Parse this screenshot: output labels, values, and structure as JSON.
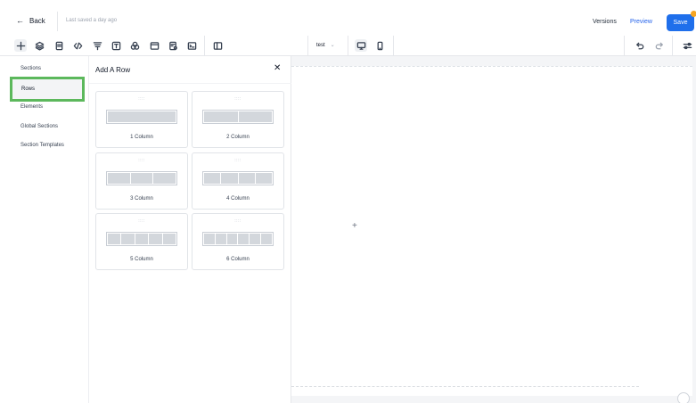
{
  "topbar": {
    "back_label": "Back",
    "back_arrow": "←",
    "saved_status": "Last saved a day ago",
    "versions_label": "Versions",
    "preview_label": "Preview",
    "save_label": "Save",
    "save_color": "#1f6feb",
    "unsaved_dot_color": "#f5a524"
  },
  "toolbar": {
    "tools": [
      "add-icon",
      "layers-icon",
      "page-icon",
      "code-icon",
      "funnel-icon",
      "text-icon",
      "shapes-icon",
      "browser-icon",
      "form-icon",
      "terminal-icon",
      "columns-icon"
    ],
    "device_select": {
      "value": "test",
      "chevron": "⌄"
    },
    "devices": [
      "desktop-icon",
      "mobile-icon"
    ],
    "history": [
      "undo-icon",
      "redo-icon"
    ],
    "settings": "sliders-icon"
  },
  "leftnav": {
    "items": [
      "Sections",
      "Rows",
      "Elements",
      "Global Sections",
      "Section Templates"
    ],
    "active_index": 1,
    "highlight_color": "#5cb85c"
  },
  "panel": {
    "title": "Add A Row",
    "close": "✕",
    "grip": "::::",
    "rows": [
      {
        "label": "1 Column",
        "columns": 1
      },
      {
        "label": "2 Column",
        "columns": 2
      },
      {
        "label": "3 Column",
        "columns": 3
      },
      {
        "label": "4 Column",
        "columns": 4
      },
      {
        "label": "5 Column",
        "columns": 5
      },
      {
        "label": "6 Column",
        "columns": 6
      }
    ]
  },
  "canvas": {
    "add_symbol": "+"
  }
}
